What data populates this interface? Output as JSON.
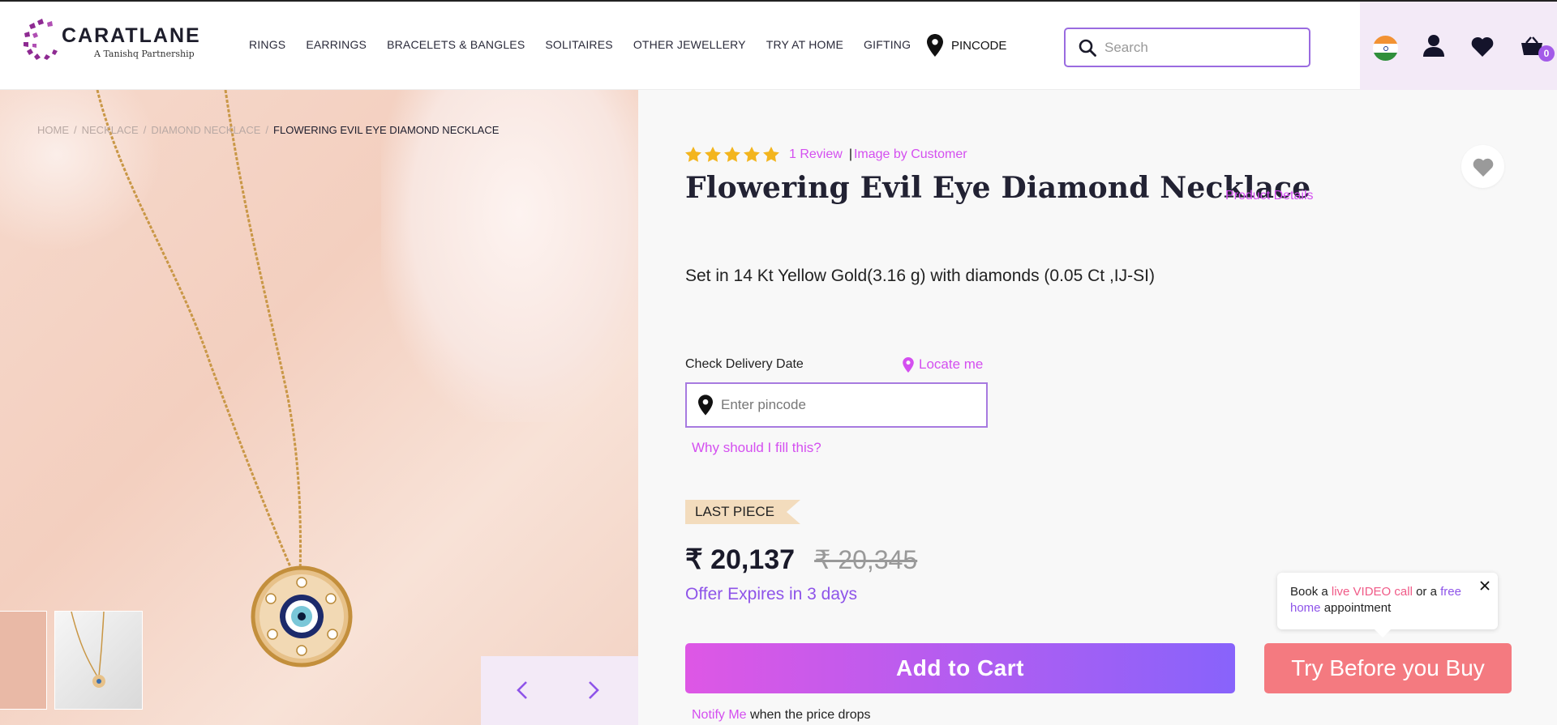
{
  "header": {
    "logo_text": "CARATLANE",
    "logo_sub": "A Tanishq Partnership",
    "nav": [
      "RINGS",
      "EARRINGS",
      "BRACELETS & BANGLES",
      "SOLITAIRES",
      "OTHER JEWELLERY",
      "TRY AT HOME",
      "GIFTING"
    ],
    "pincode_label": "PINCODE",
    "search_placeholder": "Search",
    "cart_count": "0",
    "brand_color": "#8e54e9"
  },
  "breadcrumb": {
    "items": [
      "HOME",
      "NECKLACE",
      "DIAMOND NECKLACE"
    ],
    "current": "FLOWERING EVIL EYE DIAMOND NECKLACE"
  },
  "product": {
    "rating_stars": 5,
    "reviews": "1 Review",
    "image_by": "Image by Customer",
    "title": "Flowering Evil Eye Diamond Necklace",
    "details_link": "Product Details",
    "spec": "Set in 14 Kt Yellow Gold(3.16 g) with diamonds (0.05 Ct ,IJ-SI)",
    "badge": "LAST PIECE",
    "price": "₹ 20,137",
    "mrp": "₹ 20,345",
    "offer": "Offer Expires in 3 days"
  },
  "delivery": {
    "label": "Check Delivery Date",
    "locate": "Locate me",
    "placeholder": "Enter pincode",
    "why": "Why should I fill this?"
  },
  "actions": {
    "add_to_cart": "Add to Cart",
    "try_before": "Try Before you Buy",
    "notify_link": "Notify Me",
    "notify_text": " when the price drops"
  },
  "tooltip": {
    "t1": "Book a ",
    "live": "live VIDEO call",
    "t2": " or a ",
    "free": "free home",
    "t3": " appointment"
  },
  "colors": {
    "pink_link": "#d44ff0",
    "purple": "#8e54e9",
    "try_button": "#f47a80",
    "star": "#f3b51e"
  }
}
